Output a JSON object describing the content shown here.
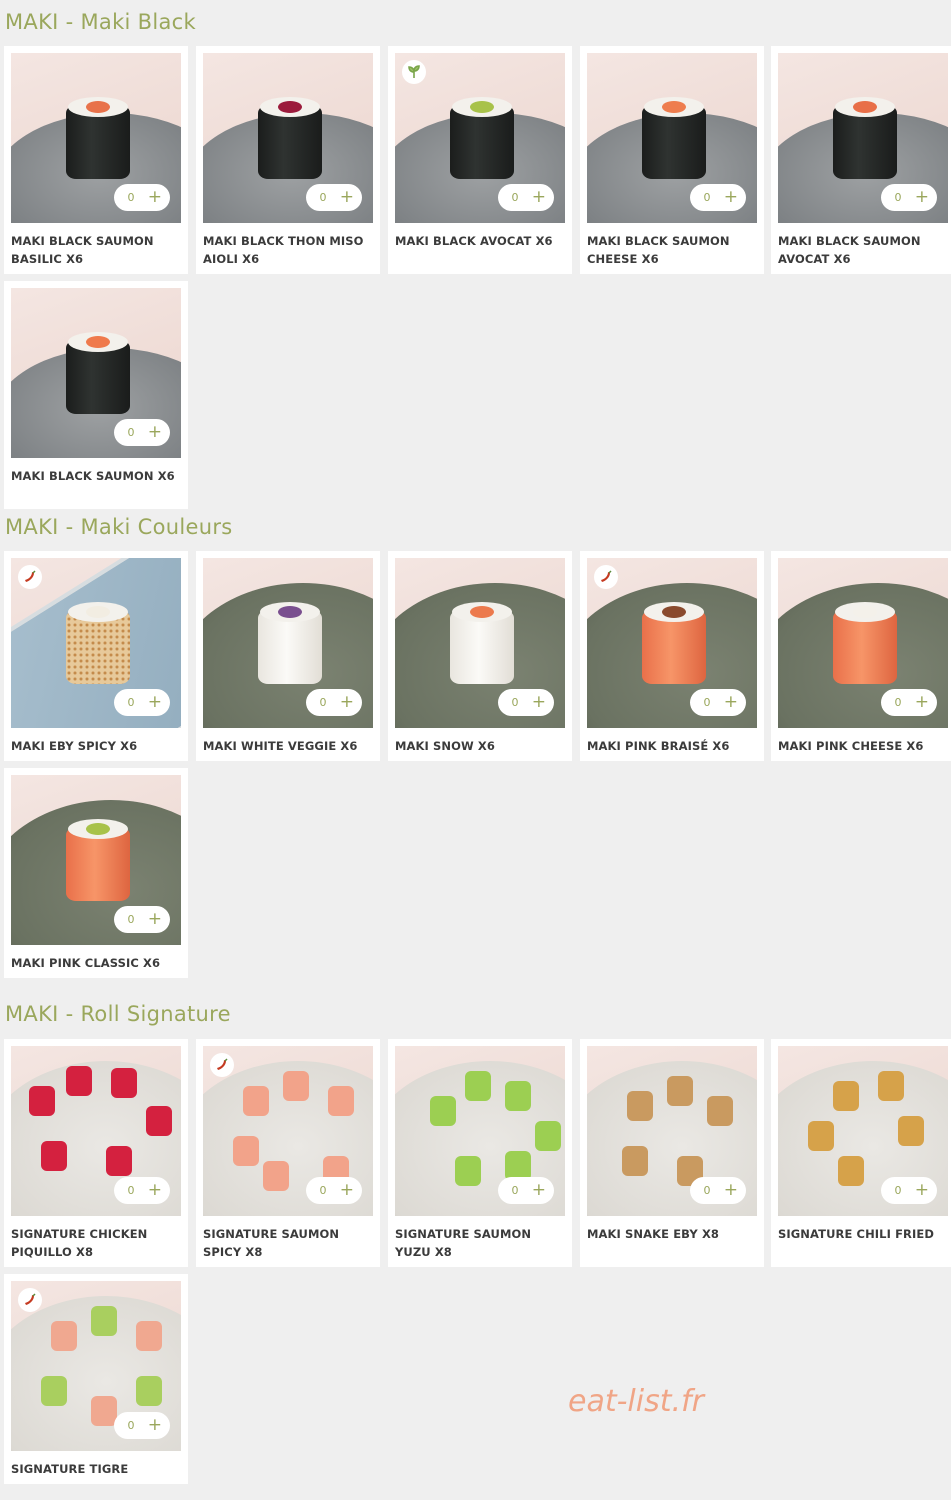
{
  "sections": [
    {
      "title": "MAKI - Maki Black",
      "items": [
        {
          "name": "MAKI BLACK SAUMON BASILIC X6",
          "qty": "0",
          "badge": ""
        },
        {
          "name": "MAKI BLACK THON MISO AIOLI X6",
          "qty": "0",
          "badge": ""
        },
        {
          "name": "MAKI BLACK AVOCAT X6",
          "qty": "0",
          "badge": "leaf-icon"
        },
        {
          "name": "MAKI BLACK SAUMON CHEESE X6",
          "qty": "0",
          "badge": ""
        },
        {
          "name": "MAKI BLACK SAUMON AVOCAT X6",
          "qty": "0",
          "badge": ""
        },
        {
          "name": "MAKI BLACK SAUMON X6",
          "qty": "0",
          "badge": ""
        }
      ]
    },
    {
      "title": "MAKI - Maki Couleurs",
      "items": [
        {
          "name": "MAKI EBY SPICY X6",
          "qty": "0",
          "badge": "chili-icon"
        },
        {
          "name": "MAKI WHITE VEGGIE X6",
          "qty": "0",
          "badge": ""
        },
        {
          "name": "MAKI SNOW X6",
          "qty": "0",
          "badge": ""
        },
        {
          "name": "MAKI PINK BRAISÉ X6",
          "qty": "0",
          "badge": "chili-icon"
        },
        {
          "name": "MAKI PINK CHEESE X6",
          "qty": "0",
          "badge": ""
        },
        {
          "name": "MAKI PINK CLASSIC X6",
          "qty": "0",
          "badge": ""
        }
      ]
    },
    {
      "title": "MAKI - Roll Signature",
      "items": [
        {
          "name": "SIGNATURE CHICKEN PIQUILLO X8",
          "qty": "0",
          "badge": ""
        },
        {
          "name": "SIGNATURE SAUMON SPICY X8",
          "qty": "0",
          "badge": "chili-icon"
        },
        {
          "name": "SIGNATURE SAUMON YUZU X8",
          "qty": "0",
          "badge": ""
        },
        {
          "name": "MAKI SNAKE EBY X8",
          "qty": "0",
          "badge": ""
        },
        {
          "name": "SIGNATURE CHILI FRIED",
          "qty": "0",
          "badge": ""
        },
        {
          "name": "SIGNATURE TIGRE",
          "qty": "0",
          "badge": "chili-icon"
        }
      ]
    }
  ],
  "stepper": {
    "plus_symbol": "+"
  },
  "watermark": "eat-list.fr",
  "colors": {
    "accent": "#9aa75c",
    "background": "#efefef",
    "chili": "#c53b22",
    "leaf": "#7aa54a"
  }
}
